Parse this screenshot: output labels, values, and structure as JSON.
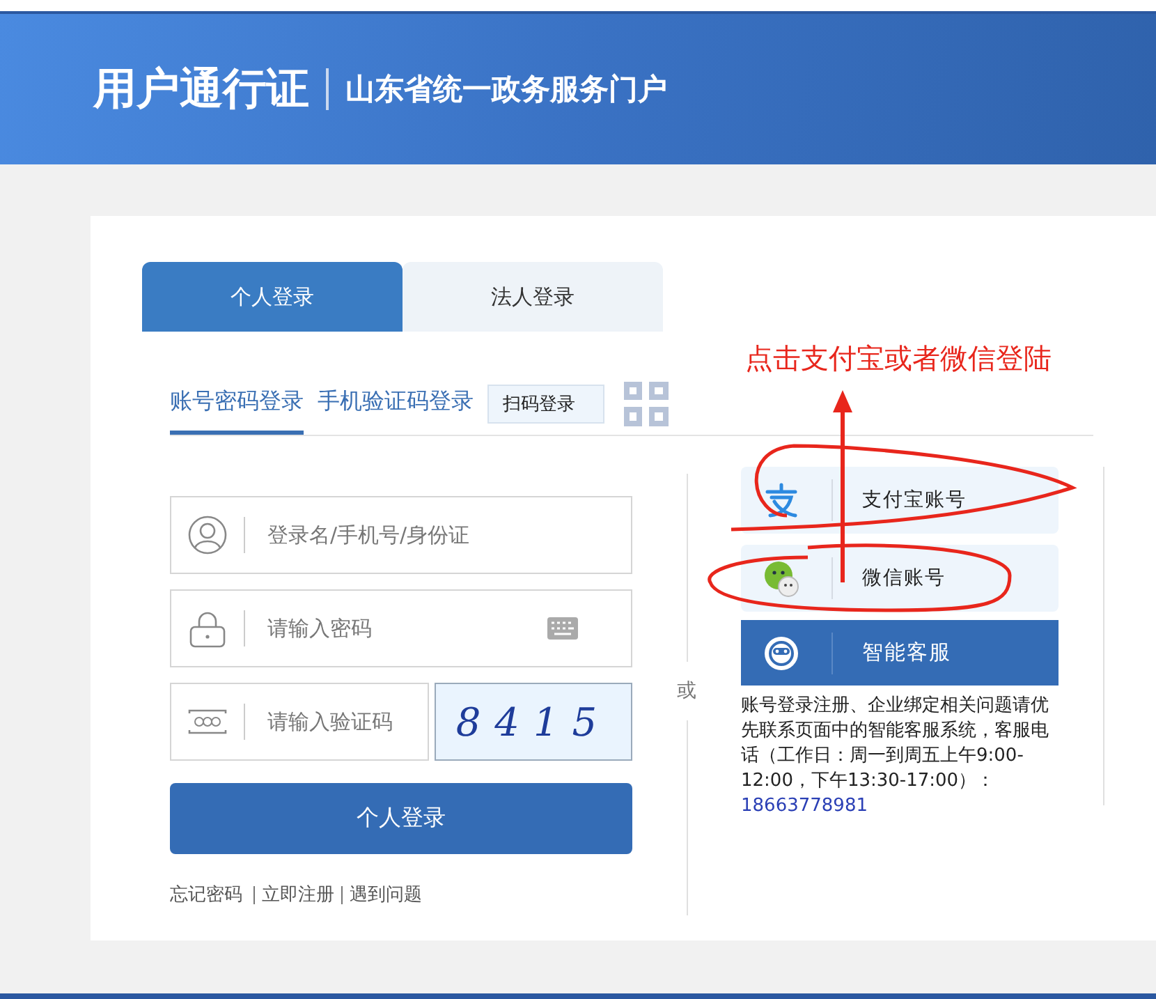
{
  "header": {
    "title": "用户通行证",
    "subtitle": "山东省统一政务服务门户"
  },
  "login_tabs": [
    {
      "label": "个人登录",
      "selected": true
    },
    {
      "label": "法人登录",
      "selected": false
    }
  ],
  "method_tabs": [
    {
      "label": "账号密码登录",
      "selected": true,
      "kind": "text"
    },
    {
      "label": "手机验证码登录",
      "selected": false,
      "kind": "text"
    },
    {
      "label": "扫码登录",
      "selected": false,
      "kind": "boxed"
    }
  ],
  "fields": [
    {
      "kind": "user",
      "placeholder": "登录名/手机号/身份证"
    },
    {
      "kind": "password",
      "placeholder": "请输入密码"
    },
    {
      "kind": "captcha",
      "placeholder": "请输入验证码",
      "captcha": "8415"
    }
  ],
  "submit": "个人登录",
  "links": [
    "忘记密码",
    "立即注册",
    "遇到问题"
  ],
  "or": "或",
  "alt_logins": [
    {
      "kind": "alipay",
      "label": "支付宝账号"
    },
    {
      "kind": "wechat",
      "label": "微信账号"
    },
    {
      "kind": "service",
      "label": "智能客服"
    }
  ],
  "help": {
    "text": "账号登录注册、企业绑定相关问题请优先联系页面中的智能客服系统，客服电话（工作日：周一到周五上午9:00-12:00，下午13:30-17:00）：",
    "phone": "18663778981"
  },
  "annotation": {
    "text": "点击支付宝或者微信登陆"
  }
}
